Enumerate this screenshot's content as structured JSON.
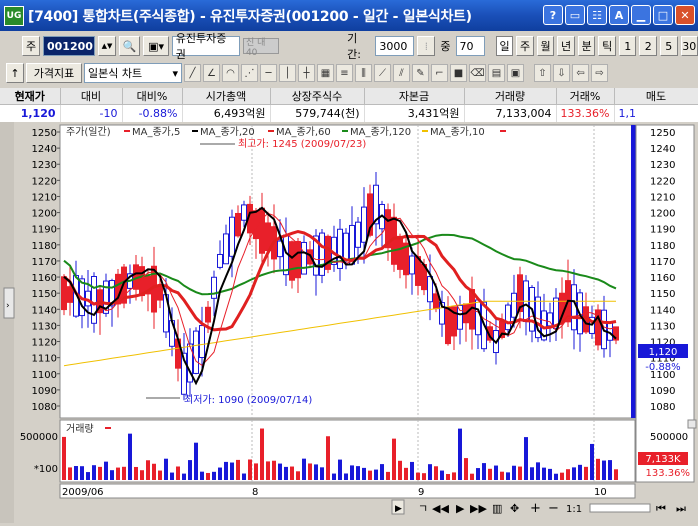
{
  "window": {
    "title": "[7400] 통합차트(주식종합) - 유진투자증권(001200 - 일간 - 일본식차트)",
    "icon_text": "UG",
    "btns": [
      "?",
      "",
      "",
      "A",
      "",
      "",
      ""
    ]
  },
  "toolbar1": {
    "market": "주",
    "code": "001200",
    "name": "유진투자증권",
    "badge": "신 대40",
    "period_label": "기간:",
    "period_value": "3000",
    "zoom_label": "중",
    "zoom_value": "70",
    "tabs": [
      "일",
      "주",
      "월",
      "년",
      "분",
      "틱",
      "1",
      "2",
      "5",
      "30"
    ]
  },
  "toolbar2": {
    "indicator": "가격지표",
    "chart_type": "일본식 차트"
  },
  "quote": {
    "headers": [
      "현재가",
      "대비",
      "대비%",
      "시가총액",
      "상장주식수",
      "자본금",
      "거래량",
      "거래%",
      "매도"
    ],
    "values": [
      "1,120",
      "-10",
      "-0.88%",
      "6,493억원",
      "579,744(천)",
      "3,431억원",
      "7,133,004",
      "133.36%",
      "1,1"
    ]
  },
  "chart": {
    "legend": [
      "주가(일간)",
      "MA_종가,5",
      "MA_종가,20",
      "MA_종가,60",
      "MA_종가,120",
      "MA_종가,10"
    ],
    "high_note": "최고가: 1245 (2009/07/23)",
    "low_note": "최저가: 1090 (2009/07/14)",
    "current_price": "1,120",
    "current_pct": "-0.88%",
    "yticks": [
      "1250",
      "1240",
      "1230",
      "1220",
      "1210",
      "1200",
      "1190",
      "1180",
      "1170",
      "1160",
      "1150",
      "1140",
      "1130",
      "1120",
      "1110",
      "1100",
      "1090",
      "1080"
    ],
    "volume_label": "거래량",
    "vol_tick": "500000",
    "vol_unit": "*100",
    "vol_current": "7,133K",
    "vol_pct": "133.36%",
    "xlabels": [
      "2009/06",
      "8",
      "9",
      "10"
    ]
  },
  "colors": {
    "up": "#e8202a",
    "down": "#1818d8",
    "ma5": "#000000",
    "ma20": "#e02020",
    "ma60": "#1a8a1a",
    "ma120": "#f0c000"
  },
  "bottom": {
    "zoom": "1:1"
  }
}
